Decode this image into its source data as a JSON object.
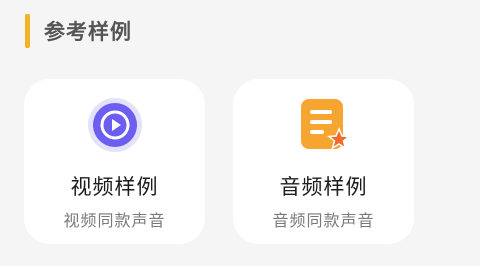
{
  "section": {
    "title": "参考样例"
  },
  "cards": [
    {
      "icon": "video-play-icon",
      "title": "视频样例",
      "subtitle": "视频同款声音"
    },
    {
      "icon": "audio-document-star-icon",
      "title": "音频样例",
      "subtitle": "音频同款声音"
    }
  ],
  "colors": {
    "accent": "#f3b322",
    "video_icon": "#6b5ef0",
    "audio_icon": "#f6a530",
    "audio_star": "#ef6a2c"
  }
}
